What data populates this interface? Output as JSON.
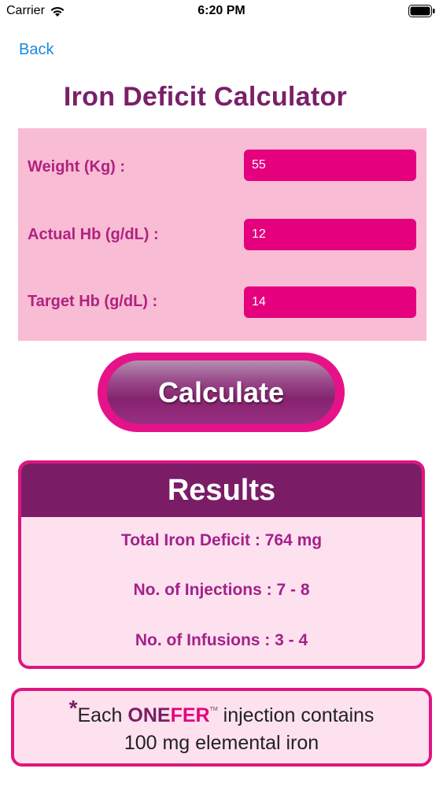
{
  "status_bar": {
    "carrier": "Carrier",
    "time": "6:20 PM"
  },
  "nav": {
    "back_label": "Back"
  },
  "title": "Iron Deficit Calculator",
  "form": {
    "weight_label": "Weight (Kg) :",
    "weight_value": "55",
    "actual_hb_label": "Actual Hb (g/dL) :",
    "actual_hb_value": "12",
    "target_hb_label": "Target Hb (g/dL) :",
    "target_hb_value": "14"
  },
  "calculate_label": "Calculate",
  "results": {
    "title": "Results",
    "total_iron_deficit": "Total Iron Deficit : 764 mg",
    "injections": "No. of Injections : 7 - 8",
    "infusions": "No. of Infusions : 3 - 4"
  },
  "note": {
    "asterisk": "*",
    "prefix": "Each ",
    "brand_one": "ONE",
    "brand_fer": "FER",
    "trademark": "TM",
    "suffix": " injection contains",
    "line2": "100 mg elemental iron"
  },
  "colors": {
    "accent_magenta": "#e5007e",
    "title_purple": "#7a1f6a",
    "panel_pink": "#f8bcd4",
    "link_blue": "#1a8ae0"
  },
  "icons": [
    "wifi-icon",
    "battery-icon"
  ]
}
